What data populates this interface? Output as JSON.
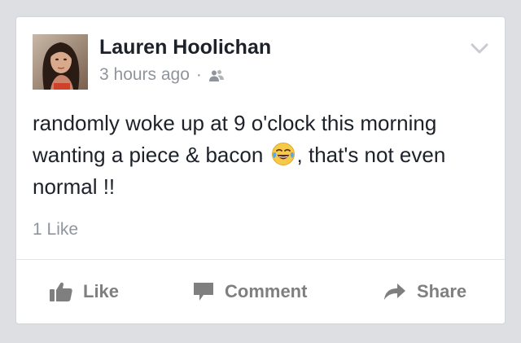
{
  "post": {
    "author": "Lauren Hoolichan",
    "timestamp": "3 hours ago",
    "separator": "·",
    "audience_icon": "friends-icon",
    "text_before_emoji": "randomly woke up at 9 o'clock this morning wanting a piece & bacon ",
    "emoji": "face-with-tears-of-joy",
    "text_after_emoji": ", that's not even normal !!",
    "like_count": "1 Like"
  },
  "actions": {
    "like_label": "Like",
    "comment_label": "Comment",
    "share_label": "Share"
  },
  "colors": {
    "background": "#dddfe2",
    "card": "#ffffff",
    "text": "#1d2129",
    "secondary_text": "#90949c",
    "action_text": "#7f7f7f"
  }
}
